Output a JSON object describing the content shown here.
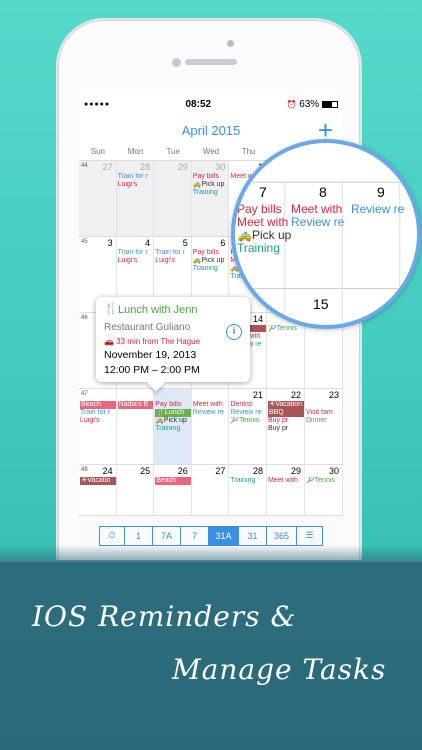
{
  "status": {
    "signal": "●●●●●",
    "time": "08:52",
    "alarm": "⏰",
    "battery": "63%"
  },
  "header": {
    "title": "April 2015",
    "add_label": "+"
  },
  "weekdays": [
    "Sun",
    "Mon",
    "Tue",
    "Wed",
    "Thu"
  ],
  "weeks": [
    {
      "wk": "44",
      "days": [
        "27",
        "28",
        "29",
        "30",
        "1"
      ],
      "events": [
        {
          "day": 1,
          "row": 0,
          "text": "Train for r",
          "color": "blue"
        },
        {
          "day": 1,
          "row": 1,
          "text": "Luigi's",
          "color": "red"
        },
        {
          "day": 3,
          "row": 0,
          "text": "Pay bills",
          "color": "red"
        },
        {
          "day": 3,
          "row": 1,
          "text": "🚕Pick up",
          "color": "dark"
        },
        {
          "day": 3,
          "row": 2,
          "text": "Training",
          "color": "teal"
        },
        {
          "day": 4,
          "row": 0,
          "text": "Meet w",
          "color": "red"
        }
      ]
    },
    {
      "wk": "45",
      "days": [
        "3",
        "4",
        "5",
        "6",
        "7"
      ],
      "events": [
        {
          "day": 1,
          "row": 0,
          "text": "Train for r",
          "color": "blue"
        },
        {
          "day": 1,
          "row": 1,
          "text": "Luigi's",
          "color": "red"
        },
        {
          "day": 2,
          "row": 0,
          "text": "Train for r",
          "color": "blue"
        },
        {
          "day": 2,
          "row": 1,
          "text": "Luigi's",
          "color": "red"
        },
        {
          "day": 3,
          "row": 0,
          "text": "Pay bills",
          "color": "red"
        },
        {
          "day": 3,
          "row": 1,
          "text": "🚕Pick up",
          "color": "dark"
        },
        {
          "day": 3,
          "row": 2,
          "text": "Training",
          "color": "teal"
        },
        {
          "day": 4,
          "row": 0,
          "text": "Pay b",
          "color": "red"
        },
        {
          "day": 4,
          "row": 1,
          "text": "Meet",
          "color": "red"
        },
        {
          "day": 4,
          "row": 2,
          "text": "🚕Pic",
          "color": "dark"
        },
        {
          "day": 4,
          "row": 3,
          "text": "Trair",
          "color": "teal"
        }
      ]
    },
    {
      "wk": "46",
      "days": [
        "",
        "",
        "",
        "",
        "14"
      ],
      "events": [
        {
          "day": 4,
          "row": 0,
          "text": "",
          "color": "bar brown"
        },
        {
          "day": 4,
          "row": 1,
          "text": "Meet with",
          "color": "red"
        },
        {
          "day": 4,
          "row": 2,
          "text": "Review re",
          "color": "blue"
        }
      ]
    },
    {
      "wk": "47",
      "days": [
        "",
        "",
        "",
        "",
        ""
      ],
      "events": [
        {
          "day": 0,
          "row": 0,
          "text": "Beach",
          "color": "bar pink"
        },
        {
          "day": 0,
          "row": 1,
          "text": "Train for r",
          "color": "blue"
        },
        {
          "day": 0,
          "row": 2,
          "text": "Luigi's",
          "color": "red"
        },
        {
          "day": 1,
          "row": 0,
          "text": "Nadia's B",
          "color": "bar pink"
        },
        {
          "day": 2,
          "row": 0,
          "text": "Pay bills",
          "color": "red"
        },
        {
          "day": 2,
          "row": 1,
          "text": "🍴Lunch",
          "color": "bar green"
        },
        {
          "day": 2,
          "row": 2,
          "text": "🚕Pick up",
          "color": "dark"
        },
        {
          "day": 2,
          "row": 3,
          "text": "Training",
          "color": "teal"
        },
        {
          "day": 3,
          "row": 0,
          "text": "Meet with",
          "color": "red"
        },
        {
          "day": 3,
          "row": 1,
          "text": "Review re",
          "color": "blue"
        },
        {
          "day": 4,
          "row": 0,
          "text": "Dentist",
          "color": "red"
        },
        {
          "day": 4,
          "row": 1,
          "text": "Review re",
          "color": "blue"
        },
        {
          "day": 4,
          "row": 2,
          "text": "🎾Tennis",
          "color": "green"
        }
      ]
    },
    {
      "wk": "48",
      "days": [
        "24",
        "25",
        "26",
        "27",
        "28"
      ],
      "events": [
        {
          "day": 0,
          "row": 0,
          "text": "☀Vacatio",
          "color": "bar brown"
        },
        {
          "day": 2,
          "row": 0,
          "text": "Beach",
          "color": "bar pink"
        },
        {
          "day": 4,
          "row": 0,
          "text": "Training",
          "color": "teal"
        }
      ]
    }
  ],
  "right_col": {
    "r1": {
      "num": "",
      "events": []
    },
    "r2": {
      "num": "",
      "events": []
    },
    "r3": {
      "num": "",
      "events": [
        {
          "text": "🎾Tennis",
          "color": "green"
        }
      ]
    },
    "r4": {
      "events": [
        {
          "text": "☀Vacation",
          "color": "bar brown"
        },
        {
          "text": "BBQ",
          "color": "bar brown"
        },
        {
          "text": "Buy pr",
          "color": "red"
        },
        {
          "text": "Buy pr",
          "color": "dark"
        },
        {
          "text": "Visit fam",
          "color": "red"
        },
        {
          "text": "Dinner",
          "color": "green"
        }
      ]
    },
    "r5": {
      "nums": [
        "29",
        "30"
      ],
      "events": [
        {
          "text": "Meet with",
          "color": "red"
        },
        {
          "text": "🎾Tennis",
          "color": "green"
        }
      ]
    },
    "r3nums": [
      "15"
    ],
    "r4nums": [
      "21",
      "22",
      "23"
    ]
  },
  "popup": {
    "icon": "fork-knife-icon",
    "title": "Lunch with Jenn",
    "location": "Restaurant Guliano",
    "distance": "🚗 33 min from The Hague",
    "date": "November 19, 2013",
    "time": "12:00 PM – 2:00 PM",
    "info_label": "i"
  },
  "magnifier": {
    "nums": [
      "7",
      "8",
      "9"
    ],
    "events_7": [
      "Pay bills",
      "Meet with",
      "🚕Pick up",
      "Training"
    ],
    "events_8": [
      "Meet with",
      "Review re"
    ],
    "events_9": [
      "Review re"
    ],
    "num_bottom": "15"
  },
  "toolbar": {
    "buttons": [
      {
        "label": "⏱",
        "name": "dial-icon-button"
      },
      {
        "label": "1"
      },
      {
        "label": "7A"
      },
      {
        "label": "7"
      },
      {
        "label": "31A",
        "selected": true
      },
      {
        "label": "31"
      },
      {
        "label": "365"
      },
      {
        "label": "☰",
        "name": "list-icon-button"
      }
    ]
  },
  "promo": {
    "line1": "IOS Reminders &",
    "line2": "Manage Tasks"
  },
  "colors": {
    "accent": "#3b8fe0",
    "background": "#44cfc1",
    "band": "#2a6979"
  }
}
